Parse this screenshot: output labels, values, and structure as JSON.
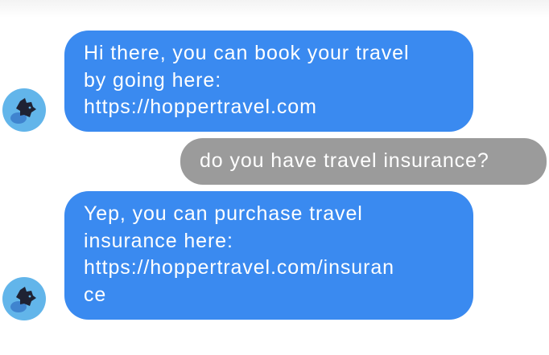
{
  "messages": [
    {
      "sender": "bot",
      "lines": [
        "Hi there, you can book your travel",
        "by going here:",
        "https://hoppertravel.com"
      ]
    },
    {
      "sender": "user",
      "text": "do you have travel insurance?"
    },
    {
      "sender": "bot",
      "lines": [
        "Yep, you can purchase travel",
        "insurance here:",
        "https://hoppertravel.com/insuran",
        "ce"
      ]
    }
  ],
  "colors": {
    "bot_bubble": "#3a8af0",
    "user_bubble": "#9b9b9b",
    "avatar_bg": "#62b5ea"
  },
  "avatar_icon": "bunny-mascot-icon"
}
